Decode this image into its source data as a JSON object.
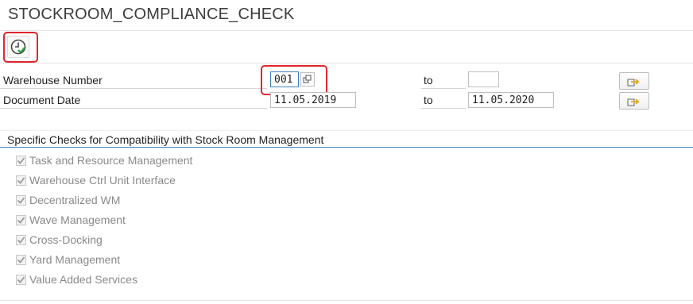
{
  "header": {
    "title": "STOCKROOM_COMPLIANCE_CHECK"
  },
  "toolbar": {
    "execute_icon": "execute-clock-check-icon"
  },
  "selection": {
    "warehouse": {
      "label": "Warehouse Number",
      "from": "001",
      "to_label": "to",
      "to": ""
    },
    "docdate": {
      "label": "Document Date",
      "from": "11.05.2019",
      "to_label": "to",
      "to": "11.05.2020"
    },
    "multiple_selection_icon": "arrow-right-icon"
  },
  "checks": {
    "title": "Specific Checks for Compatibility with Stock Room Management",
    "items": [
      {
        "label": "Task and Resource Management",
        "checked": true
      },
      {
        "label": "Warehouse Ctrl Unit Interface",
        "checked": true
      },
      {
        "label": "Decentralized WM",
        "checked": true
      },
      {
        "label": "Wave Management",
        "checked": true
      },
      {
        "label": "Cross-Docking",
        "checked": true
      },
      {
        "label": "Yard Management",
        "checked": true
      },
      {
        "label": "Value Added Services",
        "checked": true
      }
    ]
  },
  "colors": {
    "accent": "#3a8bc4",
    "highlight": "#e0262c",
    "execute_green": "#2aa13a"
  }
}
